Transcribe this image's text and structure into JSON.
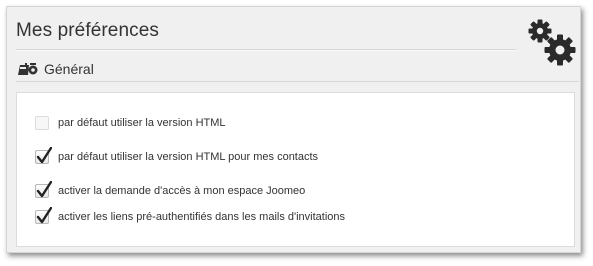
{
  "header": {
    "title": "Mes préférences",
    "icon": "gears-icon"
  },
  "section": {
    "title": "Général",
    "icon": "settings-section-icon"
  },
  "options": [
    {
      "label": "par défaut utiliser la version HTML",
      "checked": false,
      "enabled": false
    },
    {
      "label": "par défaut utiliser la version HTML pour mes contacts",
      "checked": true,
      "enabled": true
    },
    {
      "label": "activer la demande d'accès à mon espace Joomeo",
      "checked": true,
      "enabled": true
    },
    {
      "label": "activer les liens pré-authentifiés dans les mails d'invitations",
      "checked": true,
      "enabled": true
    }
  ],
  "colors": {
    "panel_bg": "#f0f0f0",
    "text": "#333333",
    "gear": "#2a2a2a"
  }
}
